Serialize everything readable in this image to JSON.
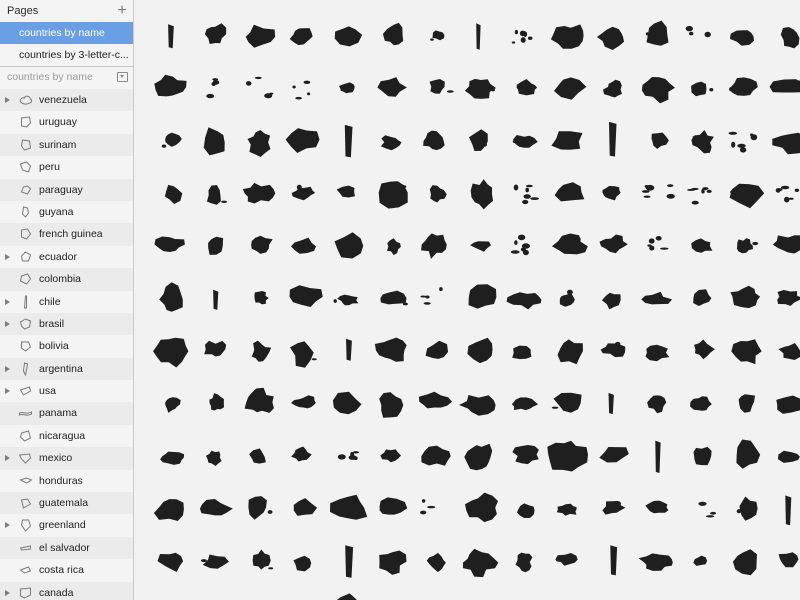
{
  "pages_panel": {
    "title": "Pages",
    "add_icon": "plus-icon",
    "items": [
      {
        "label": "countries by name",
        "selected": true
      },
      {
        "label": "countries by 3-letter-c...",
        "selected": false
      }
    ]
  },
  "layers_panel": {
    "search_placeholder": "countries by name",
    "collapse_icon": "collapse-all-icon",
    "layers": [
      {
        "label": "venezuela",
        "group": true
      },
      {
        "label": "uruguay",
        "group": false
      },
      {
        "label": "surinam",
        "group": false
      },
      {
        "label": "peru",
        "group": false
      },
      {
        "label": "paraguay",
        "group": false
      },
      {
        "label": "guyana",
        "group": false
      },
      {
        "label": "french guinea",
        "group": false
      },
      {
        "label": "ecuador",
        "group": true
      },
      {
        "label": "colombia",
        "group": false
      },
      {
        "label": "chile",
        "group": true
      },
      {
        "label": "brasil",
        "group": true
      },
      {
        "label": "bolivia",
        "group": false
      },
      {
        "label": "argentina",
        "group": true
      },
      {
        "label": "usa",
        "group": true
      },
      {
        "label": "panama",
        "group": false
      },
      {
        "label": "nicaragua",
        "group": false
      },
      {
        "label": "mexico",
        "group": true
      },
      {
        "label": "honduras",
        "group": false
      },
      {
        "label": "guatemala",
        "group": false
      },
      {
        "label": "greenland",
        "group": true
      },
      {
        "label": "el salvador",
        "group": false
      },
      {
        "label": "costa rica",
        "group": false
      },
      {
        "label": "canada",
        "group": true
      }
    ]
  },
  "canvas": {
    "description_icon": "country-silhouette",
    "columns": 15,
    "rows": 12,
    "fill_color": "#1f1f1f"
  }
}
